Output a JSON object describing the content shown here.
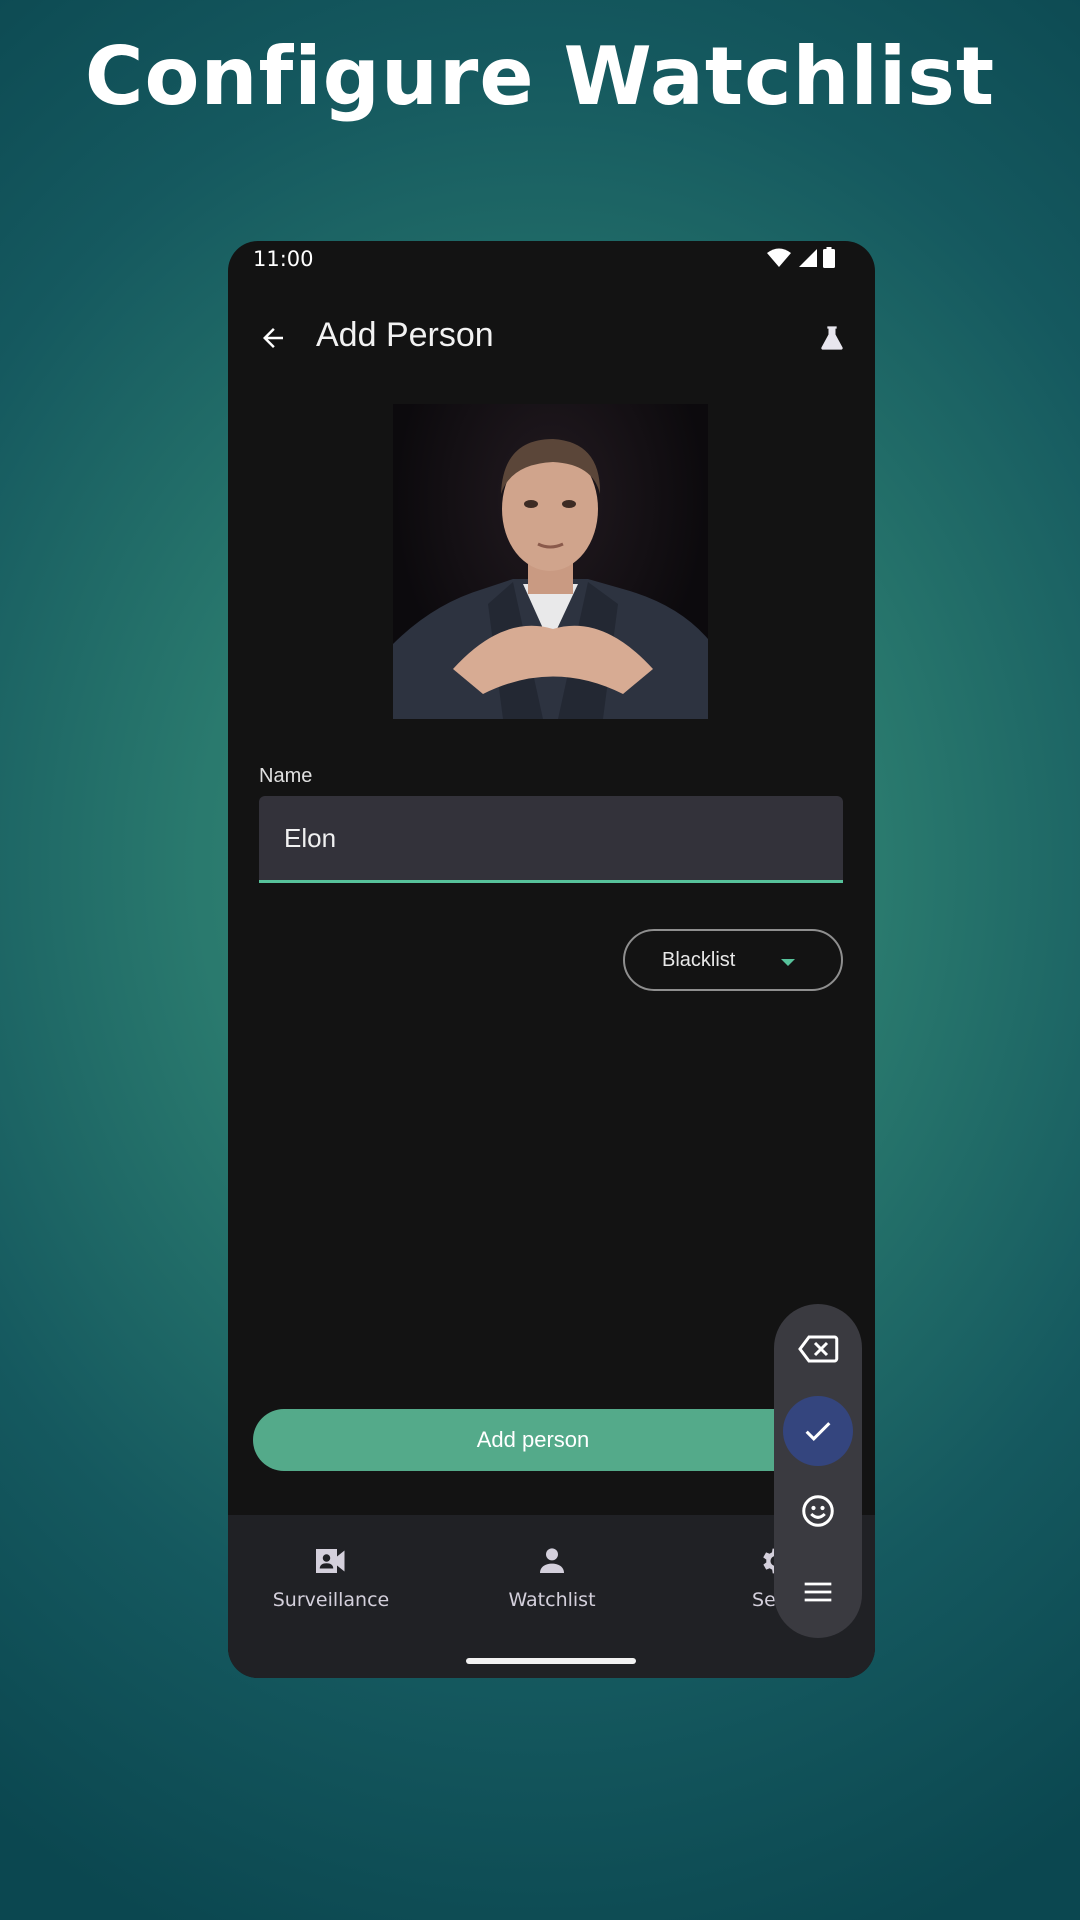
{
  "headline": "Configure Watchlist",
  "status_bar": {
    "time": "11:00"
  },
  "app_bar": {
    "title": "Add Person"
  },
  "form": {
    "name_label": "Name",
    "name_value": "Elon",
    "list_type": "Blacklist",
    "submit_label": "Add person"
  },
  "bottom_nav": {
    "items": [
      {
        "label": "Surveillance",
        "icon": "video-account-icon"
      },
      {
        "label": "Watchlist",
        "icon": "person-icon"
      },
      {
        "label": "Setti",
        "icon": "gear-icon"
      }
    ]
  },
  "keyboard_toolbar": {
    "icons": [
      "backspace-icon",
      "check-icon",
      "emoji-icon",
      "menu-icon"
    ]
  },
  "colors": {
    "accent": "#57c29b",
    "button": "#54aa8a",
    "check_bg": "#34457e"
  }
}
